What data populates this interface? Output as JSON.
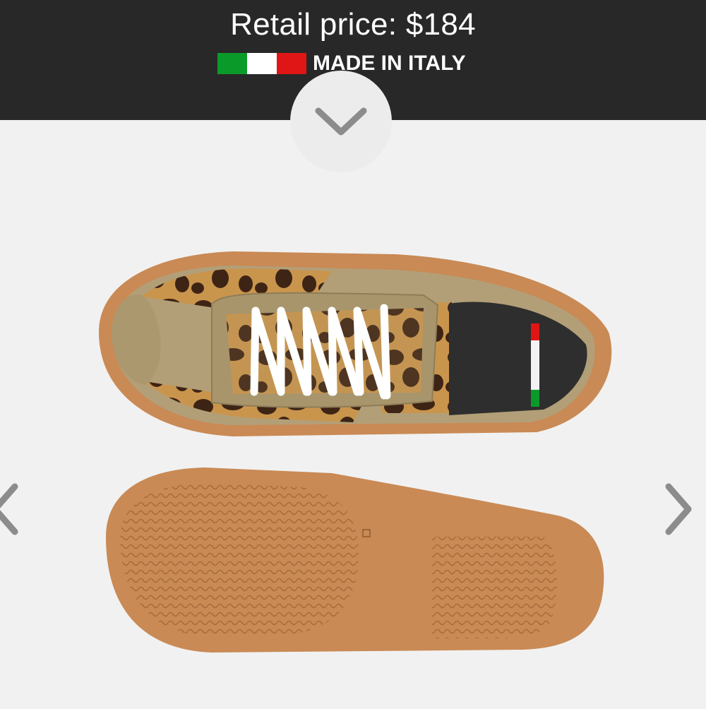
{
  "header": {
    "price_text": "Retail price: $184",
    "made_in_text": "MADE IN ITALY",
    "flag_colors": [
      "#0a9a2a",
      "#ffffff",
      "#e01515"
    ],
    "background": "#282828"
  },
  "controls": {
    "collapse_icon": "chevron-down-icon",
    "prev_icon": "chevron-left-icon",
    "next_icon": "chevron-right-icon"
  },
  "product_image": {
    "insole_label": "MADE IN ITALY",
    "colors": {
      "sole": "#c98a55",
      "upper": "#b29f78",
      "leopard_base": "#c9954d",
      "leopard_spot": "#3e2414",
      "laces": "#ffffff",
      "lining": "#2e2e2e"
    }
  }
}
